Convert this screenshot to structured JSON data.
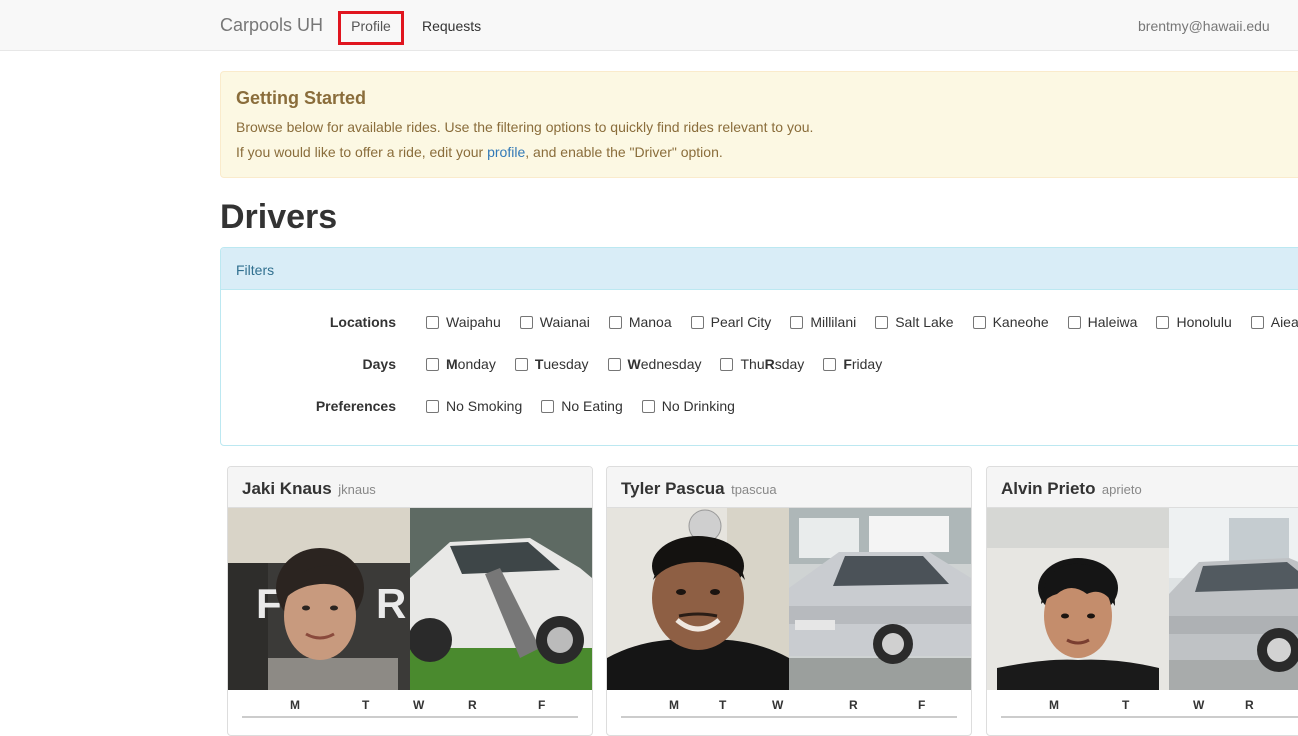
{
  "navbar": {
    "brand": "Carpools UH",
    "profile": "Profile",
    "requests": "Requests",
    "user_email": "brentmy@hawaii.edu"
  },
  "alert": {
    "title": "Getting Started",
    "line1": "Browse below for available rides. Use the filtering options to quickly find rides relevant to you.",
    "line2_before": "If you would like to offer a ride, edit your ",
    "line2_link": "profile",
    "line2_after": ", and enable the \"Driver\" option."
  },
  "drivers_heading": "Drivers",
  "filters": {
    "heading": "Filters",
    "locations_label": "Locations",
    "locations": [
      "Waipahu",
      "Waianai",
      "Manoa",
      "Pearl City",
      "Millilani",
      "Salt Lake",
      "Kaneohe",
      "Haleiwa",
      "Honolulu",
      "Aiea"
    ],
    "days_label": "Days",
    "days": [
      {
        "bold": "M",
        "rest": "onday"
      },
      {
        "bold": "T",
        "rest": "uesday"
      },
      {
        "bold": "W",
        "rest": "ednesday"
      },
      {
        "pre": "Thu",
        "bold": "R",
        "rest": "sday"
      },
      {
        "bold": "F",
        "rest": "riday"
      }
    ],
    "preferences_label": "Preferences",
    "preferences": [
      "No Smoking",
      "No Eating",
      "No Drinking"
    ]
  },
  "drivers": [
    {
      "name": "Jaki Knaus",
      "username": "jknaus",
      "days": [
        "M",
        "T",
        "W",
        "R",
        "F"
      ]
    },
    {
      "name": "Tyler Pascua",
      "username": "tpascua",
      "days": [
        "M",
        "T",
        "W",
        "R",
        "F"
      ]
    },
    {
      "name": "Alvin Prieto",
      "username": "aprieto",
      "days": [
        "M",
        "T",
        "W",
        "R"
      ]
    }
  ],
  "colors": {
    "alert_bg": "#fcf8e3",
    "alert_text": "#8a6d3b",
    "filters_heading_bg": "#d9edf7",
    "link": "#337ab7",
    "highlight_box": "#e0151f"
  }
}
